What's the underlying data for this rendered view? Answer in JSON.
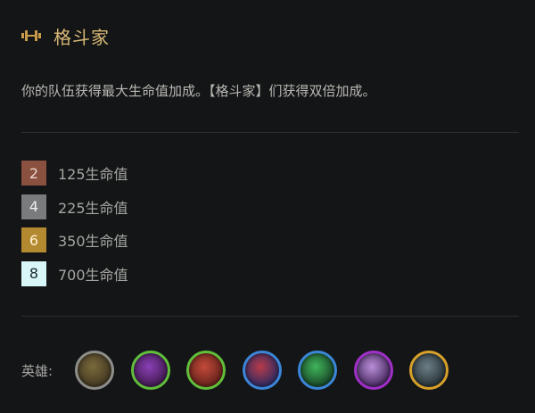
{
  "trait": {
    "icon": "dumbbell-icon",
    "name": "格斗家",
    "description": "你的队伍获得最大生命值加成。【格斗家】们获得双倍加成。"
  },
  "tiers": [
    {
      "count": "2",
      "text": "125生命值",
      "badge_color": "#8a5040",
      "text_color": "#e9d6cc"
    },
    {
      "count": "4",
      "text": "225生命值",
      "badge_color": "#7a7b7c",
      "text_color": "#efefef"
    },
    {
      "count": "6",
      "text": "350生命值",
      "badge_color": "#b38a2f",
      "text_color": "#fff3d4"
    },
    {
      "count": "8",
      "text": "700生命值",
      "badge_color": "#d9f7f9",
      "text_color": "#1c2a2c"
    }
  ],
  "champions": {
    "label": "英雄:",
    "list": [
      {
        "name": "champion-1",
        "border": "#8d8d8a",
        "fill_a": "#7a6a3a",
        "fill_b": "#3d3321"
      },
      {
        "name": "champion-2",
        "border": "#5fbf3a",
        "fill_a": "#8a3fb5",
        "fill_b": "#3a1746"
      },
      {
        "name": "champion-3",
        "border": "#5fbf3a",
        "fill_a": "#c24a3a",
        "fill_b": "#5b1d17"
      },
      {
        "name": "champion-4",
        "border": "#3b86d8",
        "fill_a": "#b83a48",
        "fill_b": "#1e2a66"
      },
      {
        "name": "champion-5",
        "border": "#3b86d8",
        "fill_a": "#3fb45a",
        "fill_b": "#153a22"
      },
      {
        "name": "champion-6",
        "border": "#a02fc8",
        "fill_a": "#b98fd8",
        "fill_b": "#3a1d52"
      },
      {
        "name": "champion-7",
        "border": "#d8a029",
        "fill_a": "#6c7f86",
        "fill_b": "#202a2e"
      }
    ]
  }
}
